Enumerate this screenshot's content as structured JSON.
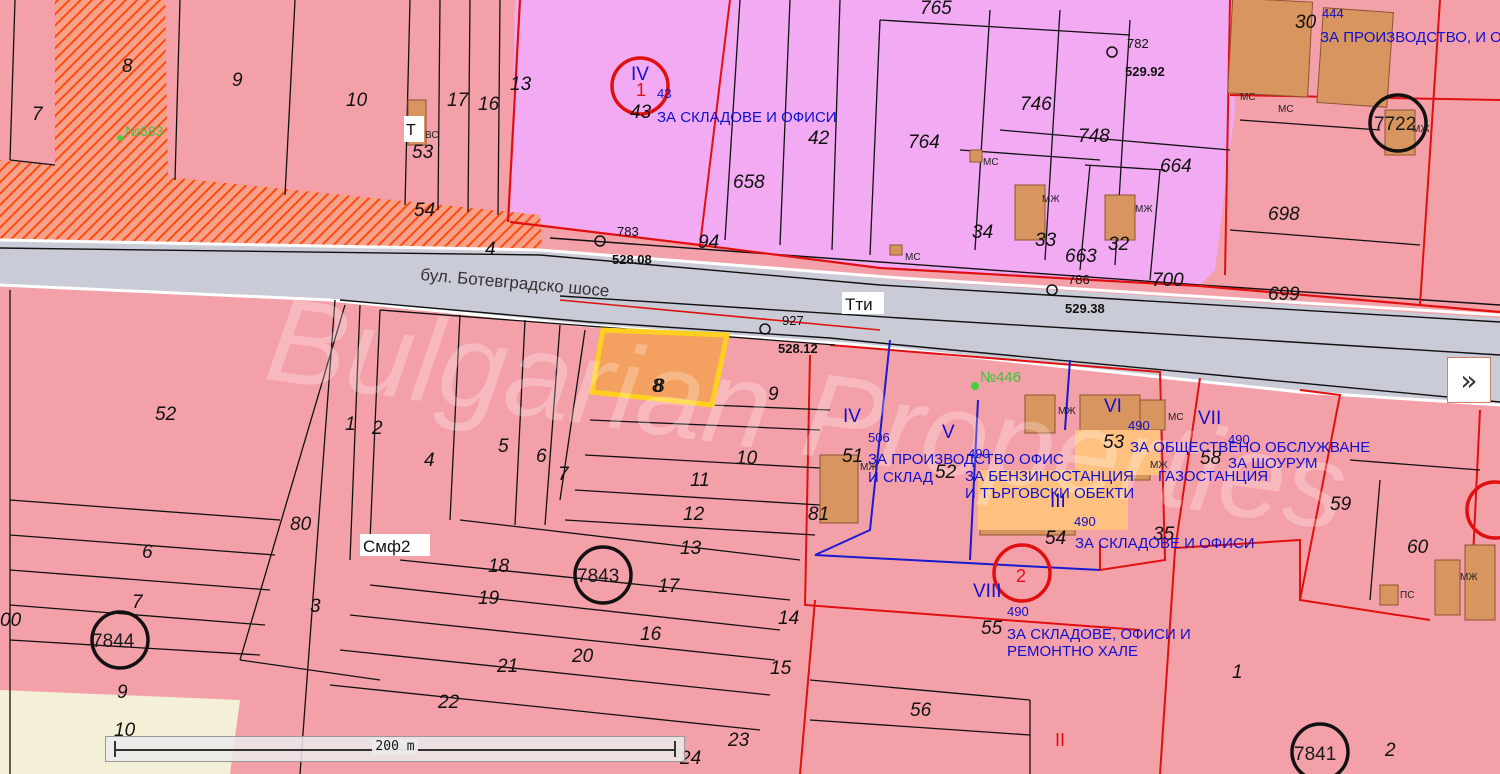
{
  "map": {
    "road_name": "бул. Ботевградско шосе",
    "road_codes": [
      "Тти",
      "Смф2",
      "Твс"
    ],
    "elevations": [
      "528.08",
      "528.12",
      "529.38",
      "529.92"
    ],
    "node_ids": [
      "783",
      "927",
      "786",
      "782"
    ],
    "block_numbers": [
      "7843",
      "7841",
      "7844",
      "7722"
    ],
    "selected_plot": "8",
    "poi_labels": [
      "№446",
      "№683"
    ],
    "zone_labels": {
      "warehouses_offices": "ЗА СКЛАДОВЕ И ОФИСИ",
      "production_offices": "ЗА ПРОИЗВОДСТВО, И ОФИСИ",
      "production_office_line1": "ЗА ПРОИЗВОДСТВО ОФИС",
      "production_office_line2": "И СКЛАД",
      "gas_station_line1": "ЗА БЕНЗИНОСТАНЦИЯ",
      "gas_station_line2": "И ТЪРГОВСКИ ОБЕКТИ",
      "public_service": "ЗА ОБЩЕСТВЕНО ОБСЛУЖВАНЕ",
      "showroom": "ЗА ШОУРУМ",
      "gas_station_short": "ГАЗОСТАНЦИЯ",
      "repair_line1": "ЗА СКЛАДОВЕ, ОФИСИ И",
      "repair_line2": "РЕМОНТНО ХАЛЕ"
    },
    "watermark": "Bulgarian Properties"
  },
  "controls": {
    "expand_label": "»",
    "scale_label": "200 m"
  },
  "colors": {
    "residential": "#f4a0a8",
    "industrial": "#f0a8f0",
    "road": "#c8ccd4",
    "hatch": "#ff5a1e",
    "selected": "#ffd020",
    "building": "#d8955a",
    "regulation_line": "#e01010",
    "zone_text": "#1010d0"
  }
}
